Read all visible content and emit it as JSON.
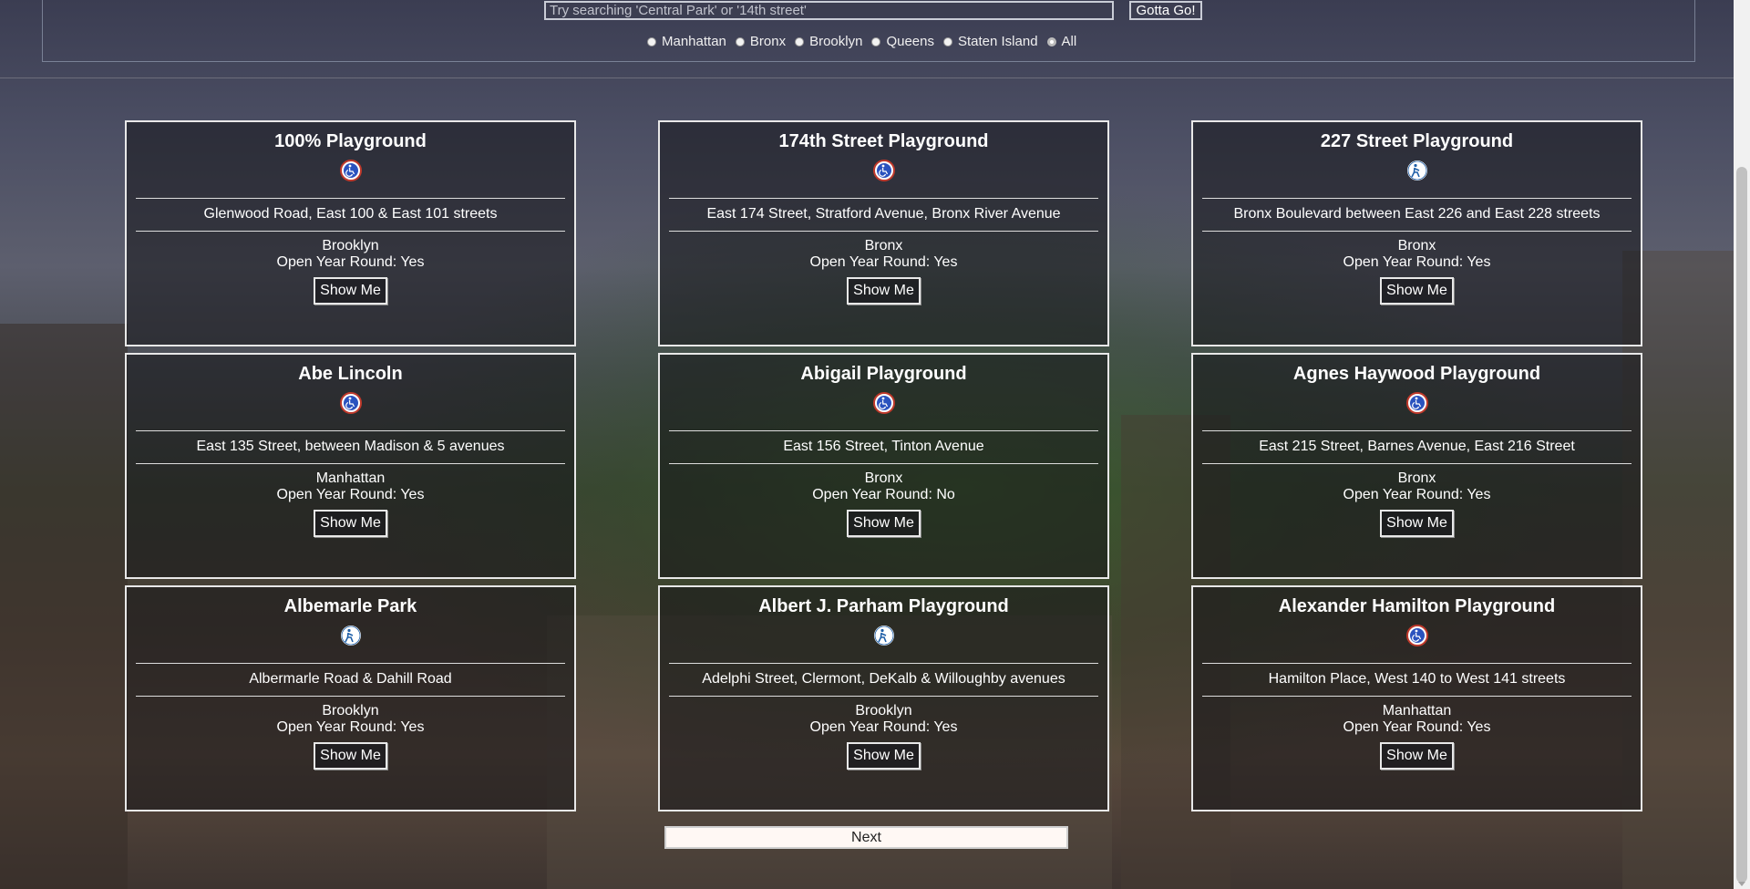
{
  "search": {
    "placeholder": "Try searching 'Central Park' or '14th street'",
    "button_label": "Gotta Go!"
  },
  "borough_filter": {
    "options": [
      "Manhattan",
      "Bronx",
      "Brooklyn",
      "Queens",
      "Staten Island",
      "All"
    ],
    "selected": "All"
  },
  "open_label_prefix": "Open Year Round:",
  "cards": [
    {
      "name": "100% Playground",
      "icon": "wheelchair-accessible-icon",
      "address": "Glenwood Road, East 100 & East 101 streets",
      "borough": "Brooklyn",
      "open_year_round": "Open Year Round: Yes",
      "button": "Show Me"
    },
    {
      "name": "174th Street Playground",
      "icon": "wheelchair-accessible-icon",
      "address": "East 174 Street, Stratford Avenue, Bronx River Avenue",
      "borough": "Bronx",
      "open_year_round": "Open Year Round: Yes",
      "button": "Show Me"
    },
    {
      "name": "227 Street Playground",
      "icon": "ambulatory-accessible-icon",
      "address": "Bronx Boulevard between East 226 and East 228 streets",
      "borough": "Bronx",
      "open_year_round": "Open Year Round: Yes",
      "button": "Show Me"
    },
    {
      "name": "Abe Lincoln",
      "icon": "wheelchair-accessible-icon",
      "address": "East 135 Street, between Madison & 5 avenues",
      "borough": "Manhattan",
      "open_year_round": "Open Year Round: Yes",
      "button": "Show Me"
    },
    {
      "name": "Abigail Playground",
      "icon": "wheelchair-accessible-icon",
      "address": "East 156 Street, Tinton Avenue",
      "borough": "Bronx",
      "open_year_round": "Open Year Round: No",
      "button": "Show Me"
    },
    {
      "name": "Agnes Haywood Playground",
      "icon": "wheelchair-accessible-icon",
      "address": "East 215 Street, Barnes Avenue, East 216 Street",
      "borough": "Bronx",
      "open_year_round": "Open Year Round: Yes",
      "button": "Show Me"
    },
    {
      "name": "Albemarle Park",
      "icon": "ambulatory-accessible-icon",
      "address": "Albermarle Road & Dahill Road",
      "borough": "Brooklyn",
      "open_year_round": "Open Year Round: Yes",
      "button": "Show Me"
    },
    {
      "name": "Albert J. Parham Playground",
      "icon": "ambulatory-accessible-icon",
      "address": "Adelphi Street, Clermont, DeKalb & Willoughby avenues",
      "borough": "Brooklyn",
      "open_year_round": "Open Year Round: Yes",
      "button": "Show Me"
    },
    {
      "name": "Alexander Hamilton Playground",
      "icon": "wheelchair-accessible-icon",
      "address": "Hamilton Place, West 140 to West 141 streets",
      "borough": "Manhattan",
      "open_year_round": "Open Year Round: Yes",
      "button": "Show Me"
    }
  ],
  "pagination": {
    "next_label": "Next"
  },
  "colors": {
    "wheelchair_icon_ring": "#c0392b",
    "wheelchair_icon_fill": "#2a52be",
    "ambulatory_icon_fill": "#1f5fa8"
  }
}
